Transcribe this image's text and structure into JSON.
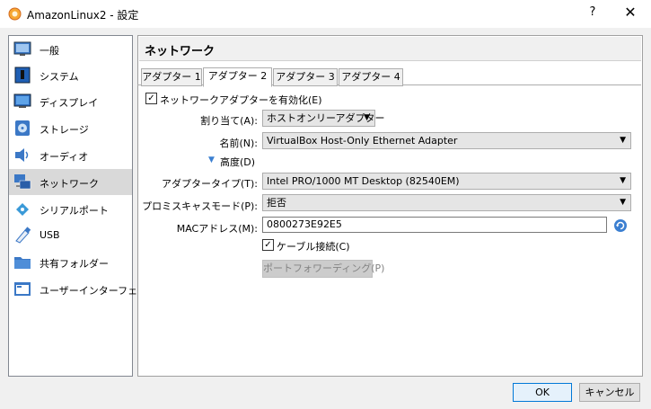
{
  "window": {
    "title": "AmazonLinux2 - 設定",
    "help_label": "?",
    "close_label": "✕"
  },
  "sidebar": {
    "items": [
      {
        "label": "一般",
        "icon": "general-icon"
      },
      {
        "label": "システム",
        "icon": "system-icon"
      },
      {
        "label": "ディスプレイ",
        "icon": "display-icon"
      },
      {
        "label": "ストレージ",
        "icon": "storage-icon"
      },
      {
        "label": "オーディオ",
        "icon": "audio-icon"
      },
      {
        "label": "ネットワーク",
        "icon": "network-icon",
        "selected": true
      },
      {
        "label": "シリアルポート",
        "icon": "serial-port-icon"
      },
      {
        "label": "USB",
        "icon": "usb-icon"
      },
      {
        "label": "共有フォルダー",
        "icon": "shared-folder-icon"
      },
      {
        "label": "ユーザーインターフェース",
        "icon": "user-interface-icon"
      }
    ]
  },
  "main": {
    "title": "ネットワーク",
    "tabs": [
      {
        "label": "アダプター 1",
        "active": false
      },
      {
        "label": "アダプター 2",
        "active": true
      },
      {
        "label": "アダプター 3",
        "active": false
      },
      {
        "label": "アダプター 4",
        "active": false
      }
    ],
    "enable_adapter": {
      "label": "ネットワークアダプターを有効化(E)",
      "checked": true
    },
    "attached_to": {
      "label": "割り当て(A):",
      "value": "ホストオンリーアダプター"
    },
    "name": {
      "label": "名前(N):",
      "value": "VirtualBox Host-Only Ethernet Adapter"
    },
    "advanced": {
      "label": "高度(D)",
      "expanded": true
    },
    "adapter_type": {
      "label": "アダプタータイプ(T):",
      "value": "Intel PRO/1000 MT Desktop (82540EM)"
    },
    "promiscuous_mode": {
      "label": "プロミスキャスモード(P):",
      "value": "拒否"
    },
    "mac_address": {
      "label": "MACアドレス(M):",
      "value": "0800273E92E5"
    },
    "cable_connected": {
      "label": "ケーブル接続(C)",
      "checked": true
    },
    "port_forwarding": {
      "label": "ポートフォワーディング(P)"
    }
  },
  "footer": {
    "ok_label": "OK",
    "cancel_label": "キャンセル"
  },
  "colors": {
    "accent": "#0078d7",
    "selected_bg": "#d9d9d9",
    "refresh_icon": "#3b7fd1"
  }
}
